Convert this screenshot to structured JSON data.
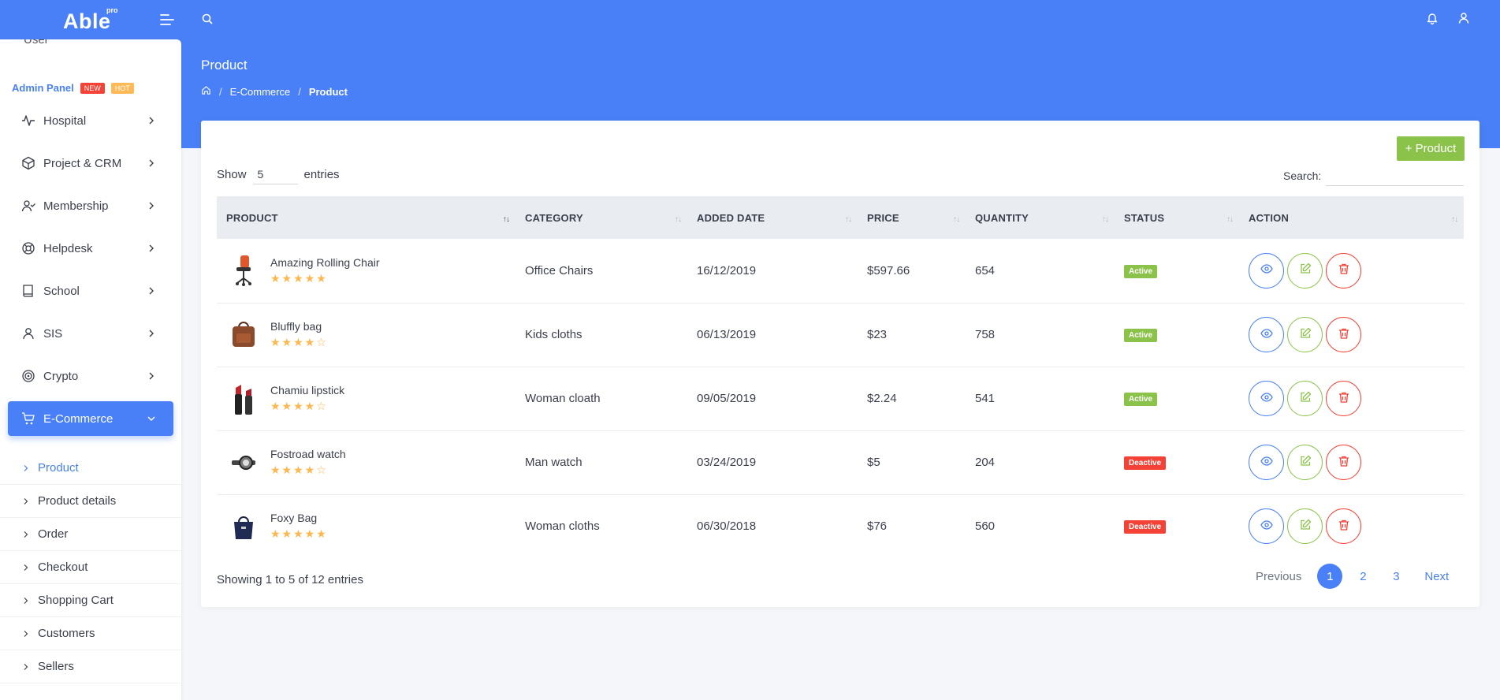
{
  "app": {
    "logo": "Able",
    "logo_badge": "pro"
  },
  "sidebar": {
    "partial_item": "User",
    "caption": "Admin Panel",
    "badge_new": "NEW",
    "badge_hot": "HOT",
    "items": [
      {
        "label": "Hospital",
        "icon": "activity-icon"
      },
      {
        "label": "Project & CRM",
        "icon": "package-icon"
      },
      {
        "label": "Membership",
        "icon": "user-check-icon"
      },
      {
        "label": "Helpdesk",
        "icon": "life-buoy-icon"
      },
      {
        "label": "School",
        "icon": "book-icon"
      },
      {
        "label": "SIS",
        "icon": "user-icon"
      },
      {
        "label": "Crypto",
        "icon": "target-icon"
      },
      {
        "label": "E-Commerce",
        "icon": "shopping-cart-icon"
      }
    ],
    "subitems": [
      "Product",
      "Product details",
      "Order",
      "Checkout",
      "Shopping Cart",
      "Customers",
      "Sellers"
    ]
  },
  "page": {
    "title": "Product",
    "breadcrumb": [
      "E-Commerce",
      "Product"
    ]
  },
  "toolbar": {
    "add_label": "+ Product",
    "show_label": "Show",
    "entries_value": "5",
    "entries_label": "entries",
    "search_label": "Search:"
  },
  "table": {
    "headers": [
      "PRODUCT",
      "CATEGORY",
      "ADDED DATE",
      "PRICE",
      "QUANTITY",
      "STATUS",
      "ACTION"
    ],
    "rows": [
      {
        "name": "Amazing Rolling Chair",
        "rating": 5,
        "stars": "★★★★★",
        "category": "Office Chairs",
        "date": "16/12/2019",
        "price": "$597.66",
        "qty": "654",
        "status": "Active"
      },
      {
        "name": "Bluffly bag",
        "rating": 4,
        "stars": "★★★★☆",
        "category": "Kids cloths",
        "date": "06/13/2019",
        "price": "$23",
        "qty": "758",
        "status": "Active"
      },
      {
        "name": "Chamiu lipstick",
        "rating": 4,
        "stars": "★★★★☆",
        "category": "Woman cloath",
        "date": "09/05/2019",
        "price": "$2.24",
        "qty": "541",
        "status": "Active"
      },
      {
        "name": "Fostroad watch",
        "rating": 4,
        "stars": "★★★★☆",
        "category": "Man watch",
        "date": "03/24/2019",
        "price": "$5",
        "qty": "204",
        "status": "Deactive"
      },
      {
        "name": "Foxy Bag",
        "rating": 5,
        "stars": "★★★★★",
        "category": "Woman cloths",
        "date": "06/30/2018",
        "price": "$76",
        "qty": "560",
        "status": "Deactive"
      }
    ]
  },
  "footer": {
    "showing": "Showing 1 to 5 of 12 entries",
    "prev": "Previous",
    "pages": [
      "1",
      "2",
      "3"
    ],
    "next": "Next"
  },
  "colors": {
    "primary": "#4a80f7",
    "success": "#8bc34a",
    "danger": "#f44236",
    "warning": "#ffb64d"
  }
}
